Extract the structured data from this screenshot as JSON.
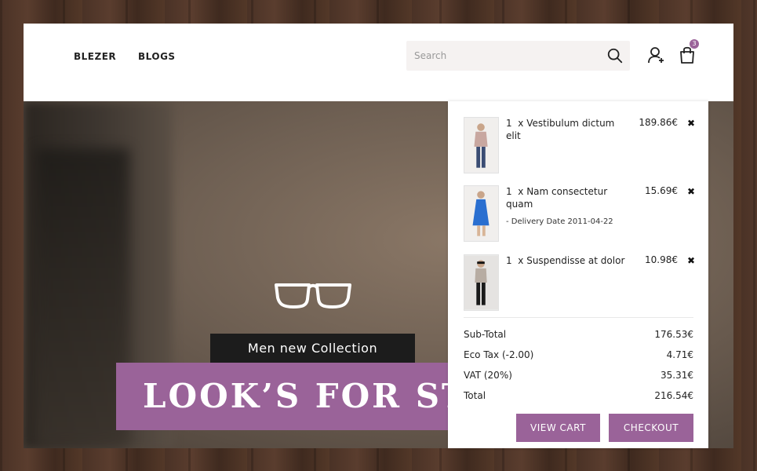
{
  "nav": {
    "links": [
      {
        "label": "BLEZER"
      },
      {
        "label": "BLOGS"
      }
    ]
  },
  "search": {
    "placeholder": "Search"
  },
  "header": {
    "cart_count": "3"
  },
  "hero": {
    "tagline": "Men new Collection",
    "headline": "LOOK’S FOR STYLE"
  },
  "cart": {
    "items": [
      {
        "qty": "1",
        "name_line1": "x Vestibulum dictum",
        "name_line2": "elit",
        "meta": "",
        "price": "189.86€"
      },
      {
        "qty": "1",
        "name_line1": "x Nam consectetur",
        "name_line2": "quam",
        "meta": "- Delivery Date 2011-04-22",
        "price": "15.69€"
      },
      {
        "qty": "1",
        "name_line1": "x Suspendisse at dolor",
        "name_line2": "",
        "meta": "",
        "price": "10.98€"
      }
    ],
    "totals": [
      {
        "label": "Sub-Total",
        "value": "176.53€"
      },
      {
        "label": "Eco Tax (-2.00)",
        "value": "4.71€"
      },
      {
        "label": "VAT (20%)",
        "value": "35.31€"
      },
      {
        "label": "Total",
        "value": "216.54€"
      }
    ],
    "view_cart_label": "VIEW CART",
    "checkout_label": "CHECKOUT"
  },
  "colors": {
    "accent": "#9a6399",
    "dark_label": "#1c1c1c"
  },
  "icons": [
    "search-icon",
    "user-add-icon",
    "shopping-bag-icon",
    "glasses-icon",
    "close-icon"
  ]
}
